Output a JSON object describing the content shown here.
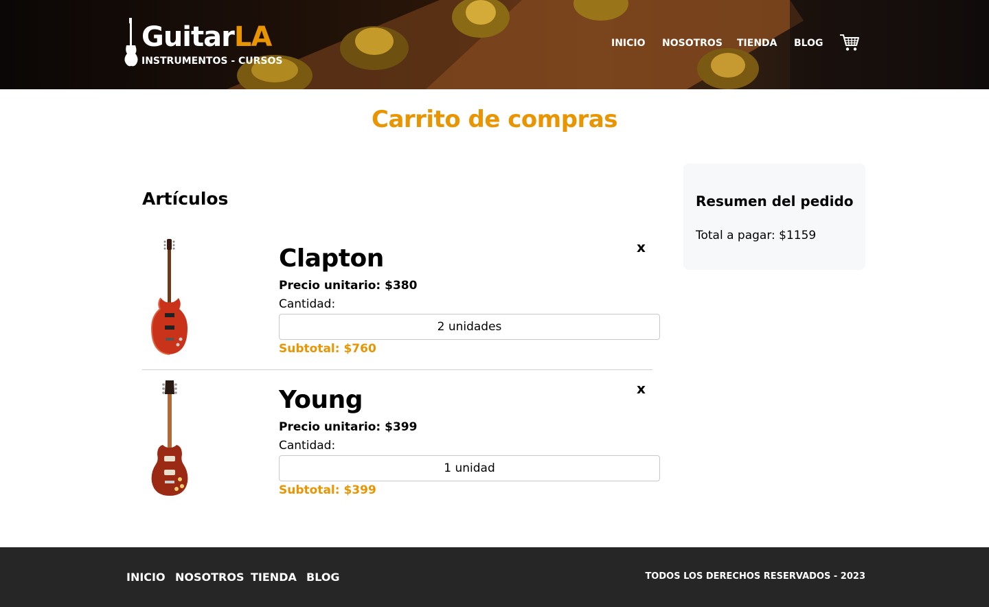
{
  "header": {
    "logo": {
      "main": "Guitar",
      "accent": "LA",
      "tagline": "INSTRUMENTOS - CURSOS"
    },
    "nav": [
      "INICIO",
      "NOSOTROS",
      "TIENDA",
      "BLOG"
    ],
    "cart_icon": "shopping-cart-icon"
  },
  "page": {
    "title": "Carrito de compras"
  },
  "articles": {
    "heading": "Artículos",
    "items": [
      {
        "name": "Clapton",
        "price": "Precio unitario: $380",
        "qty_label": "Cantidad:",
        "qty": "2 unidades",
        "subtotal": "Subtotal: $760",
        "remove": "x"
      },
      {
        "name": "Young",
        "price": "Precio unitario: $399",
        "qty_label": "Cantidad:",
        "qty": "1 unidad",
        "subtotal": "Subtotal: $399",
        "remove": "x"
      }
    ]
  },
  "summary": {
    "title": "Resumen del pedido",
    "total": "Total a pagar: $1159"
  },
  "footer": {
    "nav": [
      "INICIO",
      "NOSOTROS",
      "TIENDA",
      "BLOG"
    ],
    "copyright": "TODOS LOS DERECHOS RESERVADOS - 2023"
  },
  "colors": {
    "accent": "#e99401",
    "footer_bg": "#262626",
    "summary_bg": "#f7f8fa"
  }
}
